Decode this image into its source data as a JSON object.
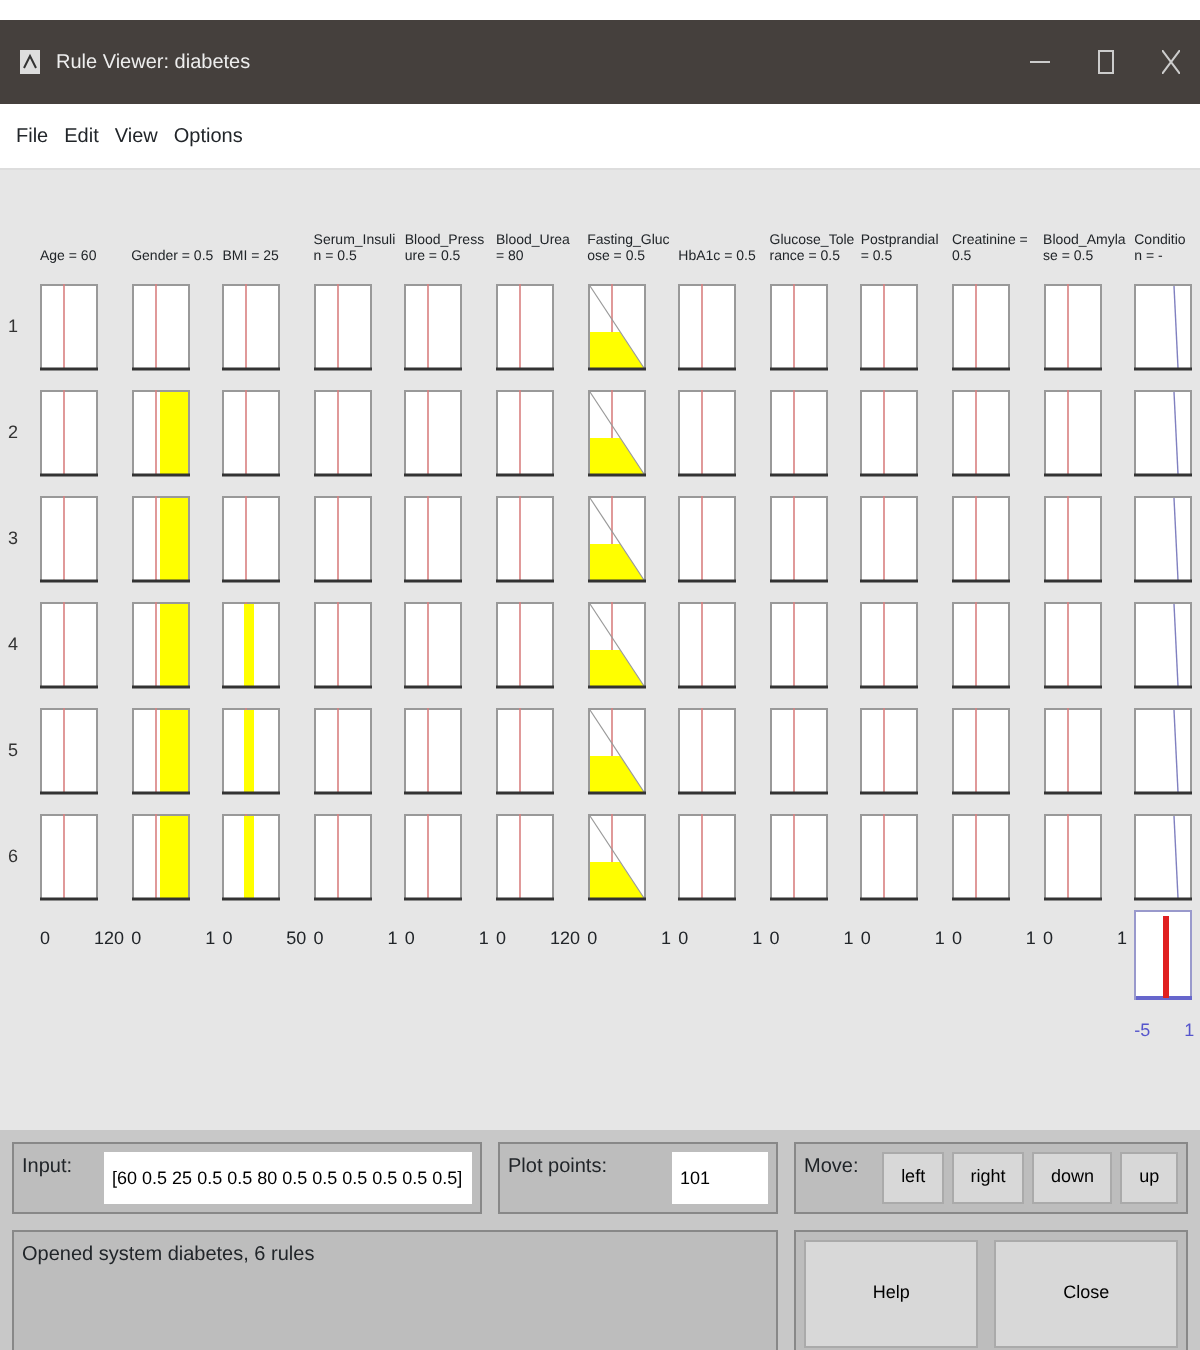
{
  "window": {
    "title": "Rule Viewer: diabetes"
  },
  "menu": [
    "File",
    "Edit",
    "View",
    "Options"
  ],
  "variables": [
    {
      "label": "Age = 60",
      "range": [
        "0",
        "120"
      ]
    },
    {
      "label": "Gender = 0.5",
      "range": [
        "0",
        "1"
      ]
    },
    {
      "label": "BMI = 25",
      "range": [
        "0",
        "50"
      ]
    },
    {
      "label": "Serum_Insulin = 0.5",
      "range": [
        "0",
        "1"
      ]
    },
    {
      "label": "Blood_Pressure = 0.5",
      "range": [
        "0",
        "1"
      ]
    },
    {
      "label": "Blood_Urea = 80",
      "range": [
        "0",
        "120"
      ]
    },
    {
      "label": "Fasting_Glucose = 0.5",
      "range": [
        "0",
        "1"
      ]
    },
    {
      "label": "HbA1c = 0.5",
      "range": [
        "0",
        "1"
      ]
    },
    {
      "label": "Glucose_Tolerance = 0.5",
      "range": [
        "0",
        "1"
      ]
    },
    {
      "label": "Postprandial = 0.5",
      "range": [
        "0",
        "1"
      ]
    },
    {
      "label": "Creatinine = 0.5",
      "range": [
        "0",
        "1"
      ]
    },
    {
      "label": "Blood_Amylase = 0.5",
      "range": [
        "0",
        "1"
      ]
    }
  ],
  "output": {
    "label": "Condition = -",
    "range": [
      "-5",
      "1"
    ]
  },
  "rules": [
    {
      "number": "1",
      "cells": [
        {
          "kind": "empty"
        },
        {
          "kind": "empty"
        },
        {
          "kind": "empty"
        },
        {
          "kind": "empty"
        },
        {
          "kind": "empty"
        },
        {
          "kind": "empty"
        },
        {
          "kind": "ramp"
        },
        {
          "kind": "empty"
        },
        {
          "kind": "empty"
        },
        {
          "kind": "empty"
        },
        {
          "kind": "empty"
        },
        {
          "kind": "empty"
        }
      ]
    },
    {
      "number": "2",
      "cells": [
        {
          "kind": "empty"
        },
        {
          "kind": "block"
        },
        {
          "kind": "empty"
        },
        {
          "kind": "empty"
        },
        {
          "kind": "empty"
        },
        {
          "kind": "empty"
        },
        {
          "kind": "ramp"
        },
        {
          "kind": "empty"
        },
        {
          "kind": "empty"
        },
        {
          "kind": "empty"
        },
        {
          "kind": "empty"
        },
        {
          "kind": "empty"
        }
      ]
    },
    {
      "number": "3",
      "cells": [
        {
          "kind": "empty"
        },
        {
          "kind": "block"
        },
        {
          "kind": "empty"
        },
        {
          "kind": "empty"
        },
        {
          "kind": "empty"
        },
        {
          "kind": "empty"
        },
        {
          "kind": "ramp"
        },
        {
          "kind": "empty"
        },
        {
          "kind": "empty"
        },
        {
          "kind": "empty"
        },
        {
          "kind": "empty"
        },
        {
          "kind": "empty"
        }
      ]
    },
    {
      "number": "4",
      "cells": [
        {
          "kind": "empty"
        },
        {
          "kind": "block"
        },
        {
          "kind": "sliver"
        },
        {
          "kind": "empty"
        },
        {
          "kind": "empty"
        },
        {
          "kind": "empty"
        },
        {
          "kind": "ramp"
        },
        {
          "kind": "empty"
        },
        {
          "kind": "empty"
        },
        {
          "kind": "empty"
        },
        {
          "kind": "empty"
        },
        {
          "kind": "empty"
        }
      ]
    },
    {
      "number": "5",
      "cells": [
        {
          "kind": "empty"
        },
        {
          "kind": "block"
        },
        {
          "kind": "sliver"
        },
        {
          "kind": "empty"
        },
        {
          "kind": "empty"
        },
        {
          "kind": "empty"
        },
        {
          "kind": "ramp"
        },
        {
          "kind": "empty"
        },
        {
          "kind": "empty"
        },
        {
          "kind": "empty"
        },
        {
          "kind": "empty"
        },
        {
          "kind": "empty"
        }
      ]
    },
    {
      "number": "6",
      "cells": [
        {
          "kind": "empty"
        },
        {
          "kind": "block"
        },
        {
          "kind": "sliver"
        },
        {
          "kind": "empty"
        },
        {
          "kind": "empty"
        },
        {
          "kind": "empty"
        },
        {
          "kind": "ramp"
        },
        {
          "kind": "empty"
        },
        {
          "kind": "empty"
        },
        {
          "kind": "empty"
        },
        {
          "kind": "empty"
        },
        {
          "kind": "empty"
        }
      ]
    }
  ],
  "input": {
    "label": "Input:",
    "value": "[60 0.5 25 0.5 0.5 80 0.5 0.5 0.5 0.5 0.5 0.5]"
  },
  "plot_points": {
    "label": "Plot points:",
    "value": "101"
  },
  "move": {
    "label": "Move:",
    "buttons": [
      "left",
      "right",
      "down",
      "up"
    ]
  },
  "status": "Opened system diabetes, 6 rules",
  "buttons": [
    "Help",
    "Close"
  ]
}
